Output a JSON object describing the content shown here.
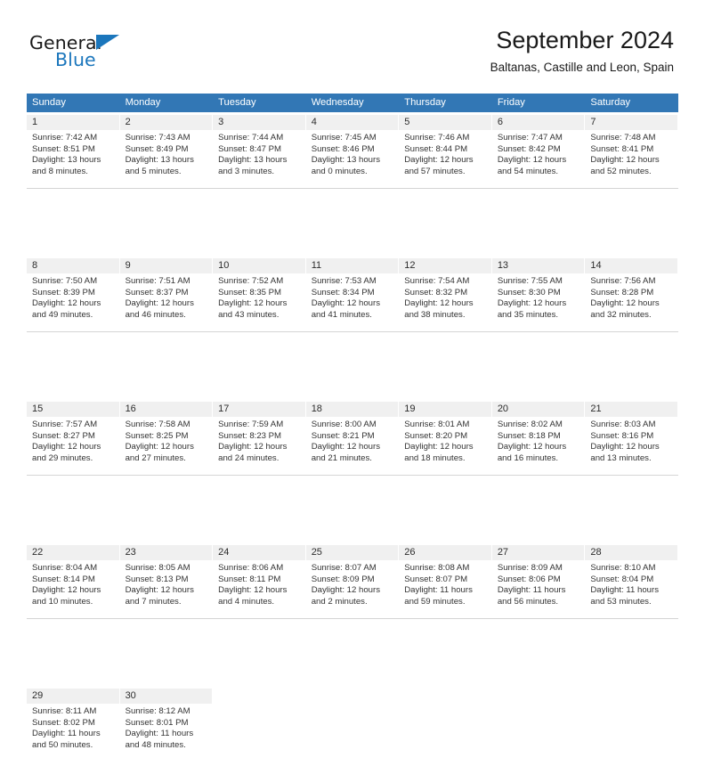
{
  "brand": {
    "name_part1": "General",
    "name_part2": "Blue",
    "mark_icon": "triangle-icon",
    "accent_color": "#1b76bc"
  },
  "header": {
    "title": "September 2024",
    "subtitle": "Baltanas, Castille and Leon, Spain"
  },
  "calendar": {
    "header_bg": "#3277b5",
    "daynum_bg": "#f0f0f0",
    "weekday_headers": [
      "Sunday",
      "Monday",
      "Tuesday",
      "Wednesday",
      "Thursday",
      "Friday",
      "Saturday"
    ],
    "weeks": [
      [
        {
          "day": "1",
          "sunrise": "Sunrise: 7:42 AM",
          "sunset": "Sunset: 8:51 PM",
          "daylight1": "Daylight: 13 hours",
          "daylight2": "and 8 minutes."
        },
        {
          "day": "2",
          "sunrise": "Sunrise: 7:43 AM",
          "sunset": "Sunset: 8:49 PM",
          "daylight1": "Daylight: 13 hours",
          "daylight2": "and 5 minutes."
        },
        {
          "day": "3",
          "sunrise": "Sunrise: 7:44 AM",
          "sunset": "Sunset: 8:47 PM",
          "daylight1": "Daylight: 13 hours",
          "daylight2": "and 3 minutes."
        },
        {
          "day": "4",
          "sunrise": "Sunrise: 7:45 AM",
          "sunset": "Sunset: 8:46 PM",
          "daylight1": "Daylight: 13 hours",
          "daylight2": "and 0 minutes."
        },
        {
          "day": "5",
          "sunrise": "Sunrise: 7:46 AM",
          "sunset": "Sunset: 8:44 PM",
          "daylight1": "Daylight: 12 hours",
          "daylight2": "and 57 minutes."
        },
        {
          "day": "6",
          "sunrise": "Sunrise: 7:47 AM",
          "sunset": "Sunset: 8:42 PM",
          "daylight1": "Daylight: 12 hours",
          "daylight2": "and 54 minutes."
        },
        {
          "day": "7",
          "sunrise": "Sunrise: 7:48 AM",
          "sunset": "Sunset: 8:41 PM",
          "daylight1": "Daylight: 12 hours",
          "daylight2": "and 52 minutes."
        }
      ],
      [
        {
          "day": "8",
          "sunrise": "Sunrise: 7:50 AM",
          "sunset": "Sunset: 8:39 PM",
          "daylight1": "Daylight: 12 hours",
          "daylight2": "and 49 minutes."
        },
        {
          "day": "9",
          "sunrise": "Sunrise: 7:51 AM",
          "sunset": "Sunset: 8:37 PM",
          "daylight1": "Daylight: 12 hours",
          "daylight2": "and 46 minutes."
        },
        {
          "day": "10",
          "sunrise": "Sunrise: 7:52 AM",
          "sunset": "Sunset: 8:35 PM",
          "daylight1": "Daylight: 12 hours",
          "daylight2": "and 43 minutes."
        },
        {
          "day": "11",
          "sunrise": "Sunrise: 7:53 AM",
          "sunset": "Sunset: 8:34 PM",
          "daylight1": "Daylight: 12 hours",
          "daylight2": "and 41 minutes."
        },
        {
          "day": "12",
          "sunrise": "Sunrise: 7:54 AM",
          "sunset": "Sunset: 8:32 PM",
          "daylight1": "Daylight: 12 hours",
          "daylight2": "and 38 minutes."
        },
        {
          "day": "13",
          "sunrise": "Sunrise: 7:55 AM",
          "sunset": "Sunset: 8:30 PM",
          "daylight1": "Daylight: 12 hours",
          "daylight2": "and 35 minutes."
        },
        {
          "day": "14",
          "sunrise": "Sunrise: 7:56 AM",
          "sunset": "Sunset: 8:28 PM",
          "daylight1": "Daylight: 12 hours",
          "daylight2": "and 32 minutes."
        }
      ],
      [
        {
          "day": "15",
          "sunrise": "Sunrise: 7:57 AM",
          "sunset": "Sunset: 8:27 PM",
          "daylight1": "Daylight: 12 hours",
          "daylight2": "and 29 minutes."
        },
        {
          "day": "16",
          "sunrise": "Sunrise: 7:58 AM",
          "sunset": "Sunset: 8:25 PM",
          "daylight1": "Daylight: 12 hours",
          "daylight2": "and 27 minutes."
        },
        {
          "day": "17",
          "sunrise": "Sunrise: 7:59 AM",
          "sunset": "Sunset: 8:23 PM",
          "daylight1": "Daylight: 12 hours",
          "daylight2": "and 24 minutes."
        },
        {
          "day": "18",
          "sunrise": "Sunrise: 8:00 AM",
          "sunset": "Sunset: 8:21 PM",
          "daylight1": "Daylight: 12 hours",
          "daylight2": "and 21 minutes."
        },
        {
          "day": "19",
          "sunrise": "Sunrise: 8:01 AM",
          "sunset": "Sunset: 8:20 PM",
          "daylight1": "Daylight: 12 hours",
          "daylight2": "and 18 minutes."
        },
        {
          "day": "20",
          "sunrise": "Sunrise: 8:02 AM",
          "sunset": "Sunset: 8:18 PM",
          "daylight1": "Daylight: 12 hours",
          "daylight2": "and 16 minutes."
        },
        {
          "day": "21",
          "sunrise": "Sunrise: 8:03 AM",
          "sunset": "Sunset: 8:16 PM",
          "daylight1": "Daylight: 12 hours",
          "daylight2": "and 13 minutes."
        }
      ],
      [
        {
          "day": "22",
          "sunrise": "Sunrise: 8:04 AM",
          "sunset": "Sunset: 8:14 PM",
          "daylight1": "Daylight: 12 hours",
          "daylight2": "and 10 minutes."
        },
        {
          "day": "23",
          "sunrise": "Sunrise: 8:05 AM",
          "sunset": "Sunset: 8:13 PM",
          "daylight1": "Daylight: 12 hours",
          "daylight2": "and 7 minutes."
        },
        {
          "day": "24",
          "sunrise": "Sunrise: 8:06 AM",
          "sunset": "Sunset: 8:11 PM",
          "daylight1": "Daylight: 12 hours",
          "daylight2": "and 4 minutes."
        },
        {
          "day": "25",
          "sunrise": "Sunrise: 8:07 AM",
          "sunset": "Sunset: 8:09 PM",
          "daylight1": "Daylight: 12 hours",
          "daylight2": "and 2 minutes."
        },
        {
          "day": "26",
          "sunrise": "Sunrise: 8:08 AM",
          "sunset": "Sunset: 8:07 PM",
          "daylight1": "Daylight: 11 hours",
          "daylight2": "and 59 minutes."
        },
        {
          "day": "27",
          "sunrise": "Sunrise: 8:09 AM",
          "sunset": "Sunset: 8:06 PM",
          "daylight1": "Daylight: 11 hours",
          "daylight2": "and 56 minutes."
        },
        {
          "day": "28",
          "sunrise": "Sunrise: 8:10 AM",
          "sunset": "Sunset: 8:04 PM",
          "daylight1": "Daylight: 11 hours",
          "daylight2": "and 53 minutes."
        }
      ],
      [
        {
          "day": "29",
          "sunrise": "Sunrise: 8:11 AM",
          "sunset": "Sunset: 8:02 PM",
          "daylight1": "Daylight: 11 hours",
          "daylight2": "and 50 minutes."
        },
        {
          "day": "30",
          "sunrise": "Sunrise: 8:12 AM",
          "sunset": "Sunset: 8:01 PM",
          "daylight1": "Daylight: 11 hours",
          "daylight2": "and 48 minutes."
        },
        {
          "day": "",
          "sunrise": "",
          "sunset": "",
          "daylight1": "",
          "daylight2": ""
        },
        {
          "day": "",
          "sunrise": "",
          "sunset": "",
          "daylight1": "",
          "daylight2": ""
        },
        {
          "day": "",
          "sunrise": "",
          "sunset": "",
          "daylight1": "",
          "daylight2": ""
        },
        {
          "day": "",
          "sunrise": "",
          "sunset": "",
          "daylight1": "",
          "daylight2": ""
        },
        {
          "day": "",
          "sunrise": "",
          "sunset": "",
          "daylight1": "",
          "daylight2": ""
        }
      ]
    ]
  }
}
